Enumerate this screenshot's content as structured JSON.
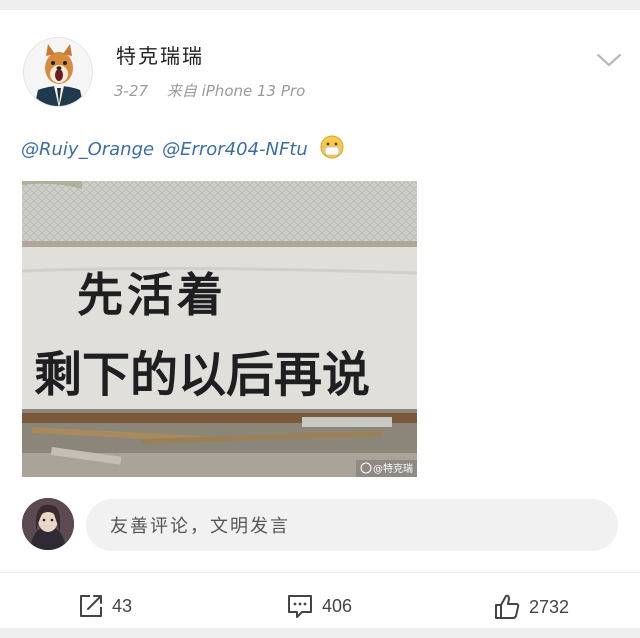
{
  "post": {
    "username": "特克瑞瑞",
    "date": "3-27",
    "source": "来自 iPhone 13 Pro",
    "mentions": [
      "@Ruiy_Orange",
      "@Error404-NFtu"
    ],
    "emoji": "mask-face-emoji",
    "image": {
      "graffiti_line1": "先活着",
      "graffiti_line2": "剩下的以后再说",
      "watermark": "@特克瑞"
    }
  },
  "comment": {
    "placeholder": "友善评论，文明发言"
  },
  "actions": {
    "share_count": "43",
    "comment_count": "406",
    "like_count": "2732"
  },
  "colors": {
    "mention_blue": "#3a6ea5",
    "background": "#f2f2f2",
    "card": "#ffffff"
  }
}
